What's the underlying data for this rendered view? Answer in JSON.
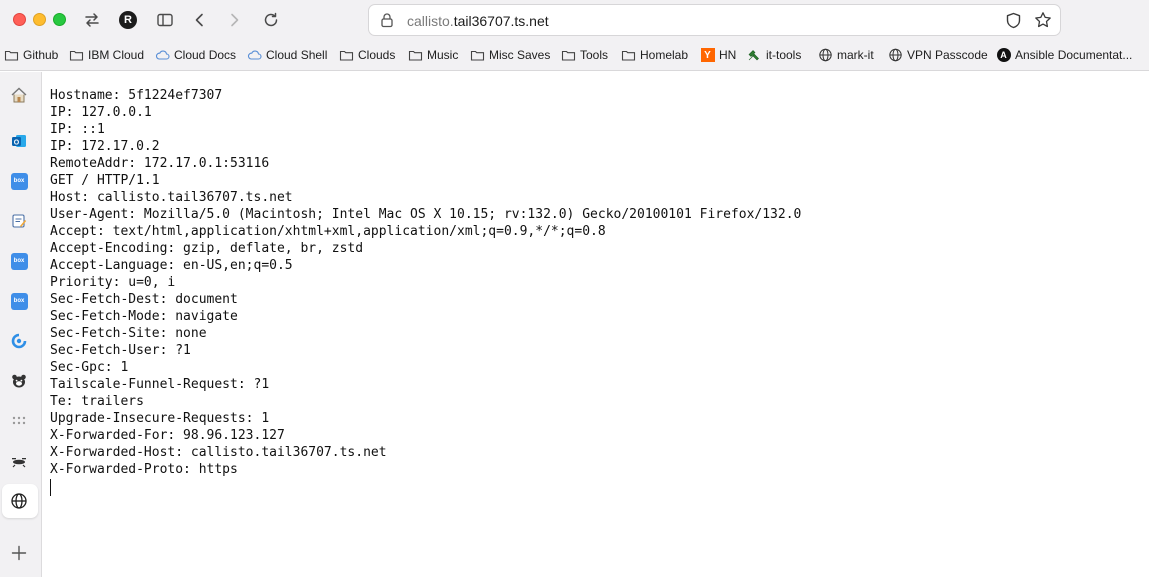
{
  "browser": {
    "url_prefix": "callisto.",
    "url_host": "tail36707.ts.net",
    "profile_initial": "R"
  },
  "bookmarks": [
    {
      "label": "Github",
      "icon": "folder-icon"
    },
    {
      "label": "IBM Cloud",
      "icon": "folder-icon"
    },
    {
      "label": "Cloud Docs",
      "icon": "cloud-icon"
    },
    {
      "label": "Cloud Shell",
      "icon": "cloud-icon"
    },
    {
      "label": "Clouds",
      "icon": "folder-icon"
    },
    {
      "label": "Music",
      "icon": "folder-icon"
    },
    {
      "label": "Misc Saves",
      "icon": "folder-icon"
    },
    {
      "label": "Tools",
      "icon": "folder-icon"
    },
    {
      "label": "Homelab",
      "icon": "folder-icon"
    },
    {
      "label": "HN",
      "icon": "hacker-news-icon",
      "badge": "Y"
    },
    {
      "label": "it-tools",
      "icon": "it-tools-icon"
    },
    {
      "label": "mark-it",
      "icon": "globe-icon"
    },
    {
      "label": "VPN Passcode",
      "icon": "globe-icon"
    },
    {
      "label": "Ansible Documentat...",
      "icon": "ansible-icon",
      "badge": "A"
    }
  ],
  "sidebar": {
    "items": [
      {
        "icon": "home-icon"
      },
      {
        "icon": "outlook-icon"
      },
      {
        "icon": "box-icon",
        "text": "box"
      },
      {
        "icon": "notes-icon"
      },
      {
        "icon": "box-icon",
        "text": "box"
      },
      {
        "icon": "box-icon",
        "text": "box"
      },
      {
        "icon": "sync-icon"
      },
      {
        "icon": "bear-icon"
      },
      {
        "icon": "dots-grid-icon"
      },
      {
        "icon": "drone-icon"
      },
      {
        "icon": "globe-icon"
      },
      {
        "icon": "plus-icon"
      }
    ]
  },
  "content": {
    "lines": [
      "Hostname: 5f1224ef7307",
      "IP: 127.0.0.1",
      "IP: ::1",
      "IP: 172.17.0.2",
      "RemoteAddr: 172.17.0.1:53116",
      "GET / HTTP/1.1",
      "Host: callisto.tail36707.ts.net",
      "User-Agent: Mozilla/5.0 (Macintosh; Intel Mac OS X 10.15; rv:132.0) Gecko/20100101 Firefox/132.0",
      "Accept: text/html,application/xhtml+xml,application/xml;q=0.9,*/*;q=0.8",
      "Accept-Encoding: gzip, deflate, br, zstd",
      "Accept-Language: en-US,en;q=0.5",
      "Priority: u=0, i",
      "Sec-Fetch-Dest: document",
      "Sec-Fetch-Mode: navigate",
      "Sec-Fetch-Site: none",
      "Sec-Fetch-User: ?1",
      "Sec-Gpc: 1",
      "Tailscale-Funnel-Request: ?1",
      "Te: trailers",
      "Upgrade-Insecure-Requests: 1",
      "X-Forwarded-For: 98.96.123.127",
      "X-Forwarded-Host: callisto.tail36707.ts.net",
      "X-Forwarded-Proto: https"
    ]
  }
}
